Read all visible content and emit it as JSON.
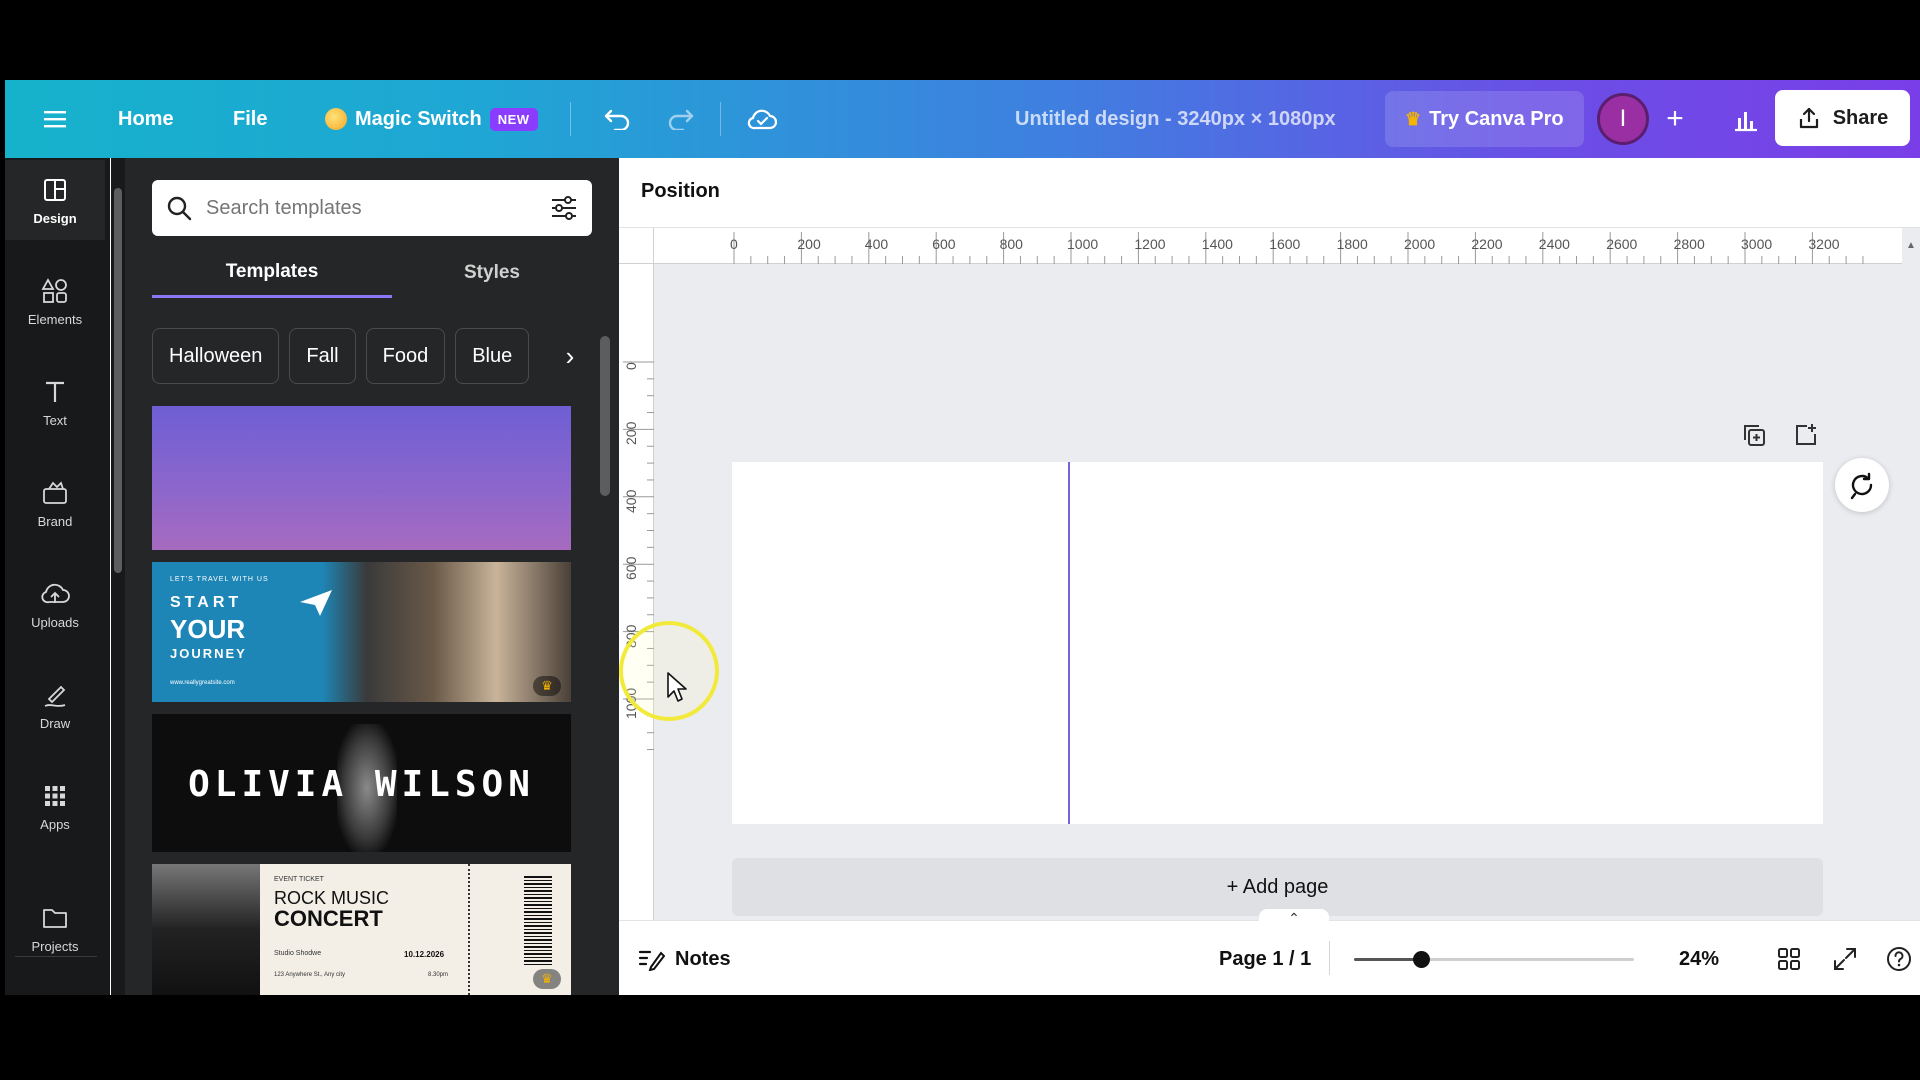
{
  "header": {
    "home_label": "Home",
    "file_label": "File",
    "magic_switch_label": "Magic Switch",
    "magic_switch_badge": "NEW",
    "design_title": "Untitled design - 3240px × 1080px",
    "try_pro_label": "Try Canva Pro",
    "avatar_initial": "I",
    "share_label": "Share"
  },
  "rail": {
    "items": [
      {
        "label": "Design",
        "icon": "design-icon"
      },
      {
        "label": "Elements",
        "icon": "elements-icon"
      },
      {
        "label": "Text",
        "icon": "text-icon"
      },
      {
        "label": "Brand",
        "icon": "brand-icon"
      },
      {
        "label": "Uploads",
        "icon": "uploads-icon"
      },
      {
        "label": "Draw",
        "icon": "draw-icon"
      },
      {
        "label": "Apps",
        "icon": "apps-icon"
      },
      {
        "label": "Projects",
        "icon": "projects-icon"
      }
    ]
  },
  "panel": {
    "search_placeholder": "Search templates",
    "tabs": [
      "Templates",
      "Styles"
    ],
    "chips": [
      "Halloween",
      "Fall",
      "Food",
      "Blue"
    ],
    "templates": {
      "t2_small": "LET'S TRAVEL WITH US",
      "t2_line1": "START",
      "t2_line2": "YOUR",
      "t2_line3": "JOURNEY",
      "t2_url": "www.reallygreatsite.com",
      "t3_name": "OLIVIA WILSON",
      "t4_small": "EVENT TICKET",
      "t4_line1": "ROCK MUSIC",
      "t4_line2": "CONCERT",
      "t4_venue": "Studio Shodwe",
      "t4_date": "10.12.2026",
      "t4_address": "123 Anywhere St., Any city",
      "t4_time": "8.30pm"
    }
  },
  "workspace": {
    "position_label": "Position",
    "hruler_labels": [
      "0",
      "200",
      "400",
      "600",
      "800",
      "1000",
      "1200",
      "1400",
      "1600",
      "1800",
      "2000",
      "2200",
      "2400",
      "2600",
      "2800",
      "3000",
      "3200"
    ],
    "vruler_labels": [
      "0",
      "200",
      "400",
      "600",
      "800",
      "1000"
    ],
    "add_page_label": "+ Add page"
  },
  "footer": {
    "notes_label": "Notes",
    "page_indicator": "Page 1 / 1",
    "zoom_value": "24%",
    "zoom_fraction": 0.24
  },
  "colors": {
    "accent": "#8b3dff",
    "guide": "#7a63d8",
    "rail_bg": "#18191b",
    "panel_bg": "#252627"
  }
}
